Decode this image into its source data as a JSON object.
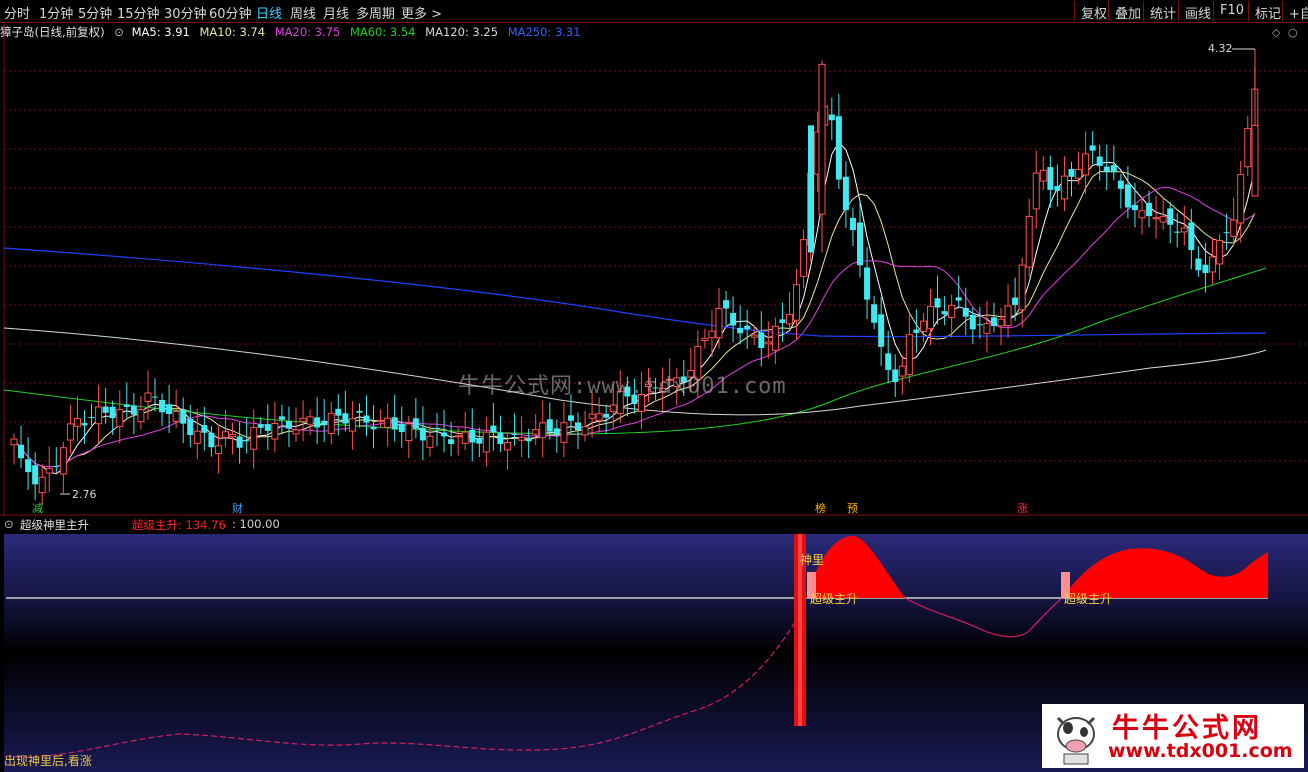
{
  "toolbar": {
    "periods": [
      "分时",
      "1分钟",
      "5分钟",
      "15分钟",
      "30分钟",
      "60分钟",
      "日线",
      "周线",
      "月线",
      "多周期",
      "更多 >"
    ],
    "active_index": 6,
    "right_buttons": [
      "复权",
      "叠加",
      "统计",
      "画线",
      "F10",
      "标记",
      "+自选"
    ]
  },
  "info": {
    "stock": "獐子岛(日线,前复权)",
    "ma5": "MA5: 3.91",
    "ma10": "MA10: 3.74",
    "ma20": "MA20: 3.75",
    "ma60": "MA60: 3.54",
    "ma120": "MA120: 3.25",
    "ma250": "MA250: 3.31"
  },
  "colors": {
    "ma5": "#ffffff",
    "ma10": "#e8e8a0",
    "ma20": "#e040e0",
    "ma60": "#20d020",
    "ma120": "#d8d8d8",
    "ma250": "#2040ff",
    "up": "#ff5050",
    "down": "#40e8f0",
    "signal": "#ff0000",
    "grid": "#7a1010"
  },
  "price_labels": {
    "high": "4.32",
    "low": "2.76"
  },
  "signals": [
    {
      "text": "减",
      "color": "#30d030"
    },
    {
      "text": "财",
      "color": "#40a0ff"
    },
    {
      "text": "榜",
      "color": "#ffb000"
    },
    {
      "text": "预",
      "color": "#ffb000"
    },
    {
      "text": "涨",
      "color": "#ff3030"
    }
  ],
  "indicator": {
    "name": "超级神里主升",
    "value_label": "超级主升: 134.76",
    "ref_label": ": 100.00",
    "annot_shenli": "神里",
    "annot_zhusheng_1": "超级主升",
    "annot_zhusheng_2": "超级主升",
    "bottom_text": "出现神里后,看涨"
  },
  "watermark": "牛牛公式网:www.tdx001.com",
  "logo": {
    "title": "牛牛公式网",
    "url": "www.tdx001.com"
  },
  "chart_data": {
    "type": "candlestick",
    "price_high": 4.32,
    "price_low": 2.76,
    "indicator_values": {
      "超级主升": 134.76,
      "reference": 100.0
    }
  }
}
